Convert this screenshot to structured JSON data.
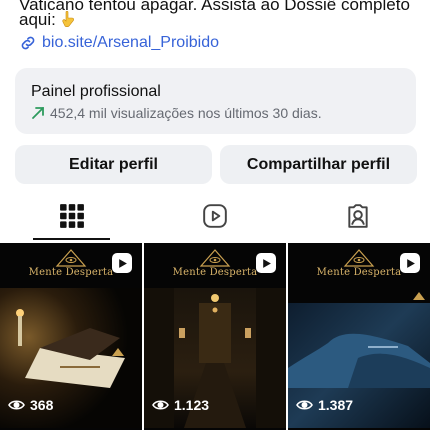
{
  "profile": {
    "bio_line_1": "Vaticano tentou apagar. Assista ao Dossiê completo",
    "bio_line_2": "aqui:",
    "bio_emoji_icon": "pointing-down-hand-emoji",
    "link_text": "bio.site/Arsenal_Proibido",
    "link_color": "#3763d8"
  },
  "dashboard": {
    "title": "Painel profissional",
    "stats": "452,4 mil visualizações nos últimos 30 dias.",
    "trend_color": "#2e9b5e"
  },
  "actions": {
    "edit_label": "Editar perfil",
    "share_label": "Compartilhar perfil"
  },
  "tabs": [
    {
      "icon": "grid-icon",
      "active": true
    },
    {
      "icon": "reels-icon",
      "active": false
    },
    {
      "icon": "tagged-icon",
      "active": false
    }
  ],
  "posts": [
    {
      "brand": "Mente Desperta",
      "views": "368",
      "scene": "hand-writing-candlelight"
    },
    {
      "brand": "Mente Desperta",
      "views": "1.123",
      "scene": "dark-hallway"
    },
    {
      "brand": "Mente Desperta",
      "views": "1.387",
      "scene": "person-sleeping-blue"
    }
  ]
}
